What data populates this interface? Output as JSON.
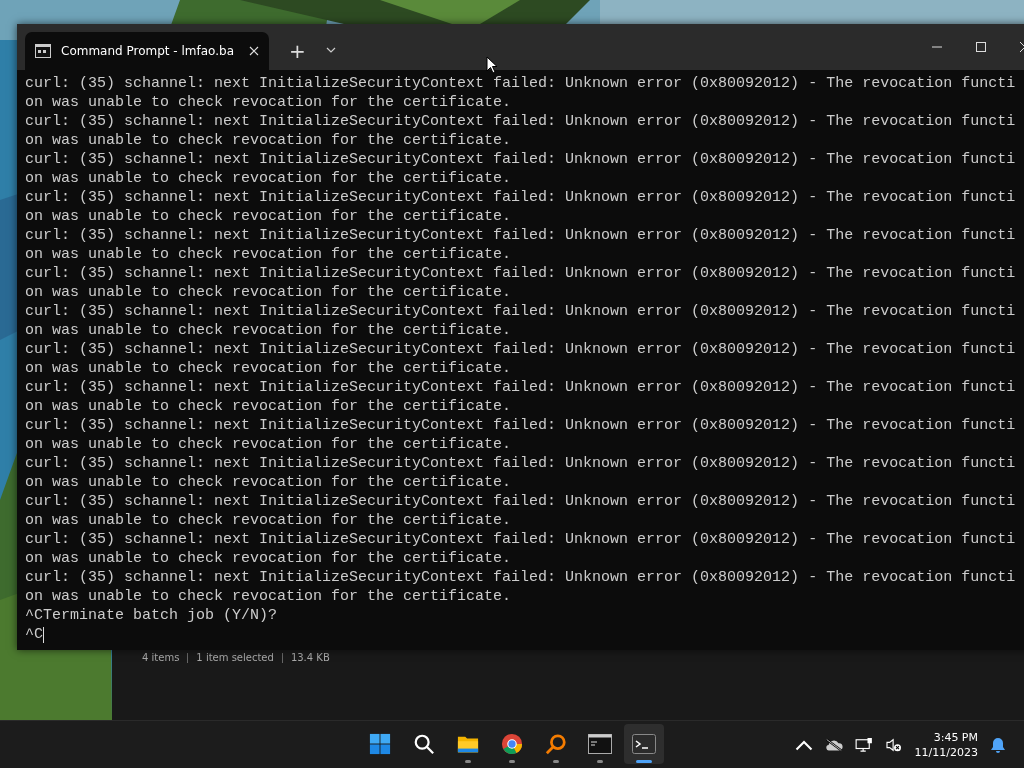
{
  "window": {
    "tab_title": "Command Prompt - lmfao.ba",
    "new_tab": "+"
  },
  "terminal": {
    "lines": [
      "curl: (35) schannel: next InitializeSecurityContext failed: Unknown error (0x80092012) - The revocation functi",
      "on was unable to check revocation for the certificate.",
      "curl: (35) schannel: next InitializeSecurityContext failed: Unknown error (0x80092012) - The revocation functi",
      "on was unable to check revocation for the certificate.",
      "curl: (35) schannel: next InitializeSecurityContext failed: Unknown error (0x80092012) - The revocation functi",
      "on was unable to check revocation for the certificate.",
      "curl: (35) schannel: next InitializeSecurityContext failed: Unknown error (0x80092012) - The revocation functi",
      "on was unable to check revocation for the certificate.",
      "curl: (35) schannel: next InitializeSecurityContext failed: Unknown error (0x80092012) - The revocation functi",
      "on was unable to check revocation for the certificate.",
      "curl: (35) schannel: next InitializeSecurityContext failed: Unknown error (0x80092012) - The revocation functi",
      "on was unable to check revocation for the certificate.",
      "curl: (35) schannel: next InitializeSecurityContext failed: Unknown error (0x80092012) - The revocation functi",
      "on was unable to check revocation for the certificate.",
      "curl: (35) schannel: next InitializeSecurityContext failed: Unknown error (0x80092012) - The revocation functi",
      "on was unable to check revocation for the certificate.",
      "curl: (35) schannel: next InitializeSecurityContext failed: Unknown error (0x80092012) - The revocation functi",
      "on was unable to check revocation for the certificate.",
      "curl: (35) schannel: next InitializeSecurityContext failed: Unknown error (0x80092012) - The revocation functi",
      "on was unable to check revocation for the certificate.",
      "curl: (35) schannel: next InitializeSecurityContext failed: Unknown error (0x80092012) - The revocation functi",
      "on was unable to check revocation for the certificate.",
      "curl: (35) schannel: next InitializeSecurityContext failed: Unknown error (0x80092012) - The revocation functi",
      "on was unable to check revocation for the certificate.",
      "curl: (35) schannel: next InitializeSecurityContext failed: Unknown error (0x80092012) - The revocation functi",
      "on was unable to check revocation for the certificate.",
      "curl: (35) schannel: next InitializeSecurityContext failed: Unknown error (0x80092012) - The revocation functi",
      "on was unable to check revocation for the certificate.",
      "^CTerminate batch job (Y/N)?"
    ],
    "prompt": "^C",
    "cursor": true
  },
  "explorer_status": [
    "4 items",
    "1 item selected",
    "13.4 KB"
  ],
  "taskbar": {
    "apps": [
      {
        "kind": "start",
        "running": false,
        "selected": false
      },
      {
        "kind": "search",
        "running": false,
        "selected": false
      },
      {
        "kind": "folder",
        "running": true,
        "selected": false
      },
      {
        "kind": "browser",
        "running": true,
        "selected": false
      },
      {
        "kind": "magnifier",
        "running": true,
        "selected": false
      },
      {
        "kind": "console",
        "running": true,
        "selected": false
      },
      {
        "kind": "terminal",
        "running": true,
        "selected": true
      }
    ],
    "time": "3:45 PM",
    "date": "11/11/2023"
  }
}
